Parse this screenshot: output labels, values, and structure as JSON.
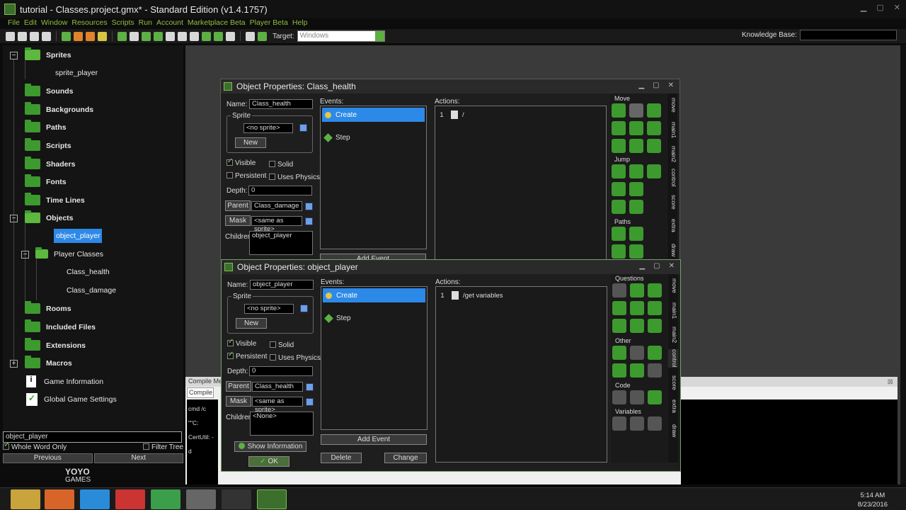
{
  "window": {
    "title": "tutorial - Classes.project.gmx* - Standard Edition (v1.4.1757)"
  },
  "menu": [
    "File",
    "Edit",
    "Window",
    "Resources",
    "Scripts",
    "Run",
    "Account",
    "Marketplace Beta",
    "Player Beta",
    "Help"
  ],
  "toolbar": {
    "target_label": "Target:",
    "target_value": "Windows",
    "knowledge_base_label": "Knowledge Base:"
  },
  "tree": {
    "sprites": "Sprites",
    "sprite_player": "sprite_player",
    "sounds": "Sounds",
    "backgrounds": "Backgrounds",
    "paths": "Paths",
    "scripts": "Scripts",
    "shaders": "Shaders",
    "fonts": "Fonts",
    "time_lines": "Time Lines",
    "objects": "Objects",
    "object_player": "object_player",
    "player_classes": "Player Classes",
    "class_health": "Class_health",
    "class_damage": "Class_damage",
    "rooms": "Rooms",
    "included_files": "Included Files",
    "extensions": "Extensions",
    "macros": "Macros",
    "game_information": "Game Information",
    "global_game_settings": "Global Game Settings"
  },
  "search": {
    "value": "object_player",
    "whole_word": "Whole Word Only",
    "filter_tree": "Filter Tree",
    "previous": "Previous",
    "next": "Next"
  },
  "logo": {
    "line1": "YOYO",
    "line2": "GAMES"
  },
  "compile": {
    "header": "Compile Me",
    "tab": "Compile",
    "line1": "cmd /c \"\"C:",
    "line2": "CertUtil: -d"
  },
  "dialog1": {
    "title": "Object Properties: Class_health",
    "name_label": "Name:",
    "name_value": "Class_health",
    "sprite_group": "Sprite",
    "sprite_value": "<no sprite>",
    "new_label": "New",
    "visible": "Visible",
    "solid": "Solid",
    "persistent": "Persistent",
    "uses_physics": "Uses Physics",
    "depth_label": "Depth:",
    "depth_value": "0",
    "parent_label": "Parent",
    "parent_value": "Class_damage",
    "mask_label": "Mask",
    "mask_value": "<same as sprite>",
    "children_label": "Children:",
    "children_value": "object_player",
    "events_label": "Events:",
    "events": [
      "Create",
      "Step"
    ],
    "add_event": "Add Event",
    "actions_label": "Actions:",
    "actions": [
      {
        "n": "1",
        "text": "/"
      }
    ],
    "lib_sections": [
      "Move",
      "Jump",
      "Paths"
    ],
    "tabs": [
      "move",
      "main1",
      "main2",
      "control",
      "score",
      "extra",
      "draw"
    ]
  },
  "dialog2": {
    "title": "Object Properties: object_player",
    "name_label": "Name:",
    "name_value": "object_player",
    "sprite_group": "Sprite",
    "sprite_value": "<no sprite>",
    "new_label": "New",
    "visible": "Visible",
    "solid": "Solid",
    "persistent": "Persistent",
    "uses_physics": "Uses Physics",
    "depth_label": "Depth:",
    "depth_value": "0",
    "parent_label": "Parent",
    "parent_value": "Class_health",
    "mask_label": "Mask",
    "mask_value": "<same as sprite>",
    "children_label": "Children:",
    "children_value": "<None>",
    "show_info": "Show Information",
    "ok": "OK",
    "events_label": "Events:",
    "events": [
      "Create",
      "Step"
    ],
    "add_event": "Add Event",
    "delete": "Delete",
    "change": "Change",
    "actions_label": "Actions:",
    "actions": [
      {
        "n": "1",
        "text": "/get variables"
      }
    ],
    "lib_sections": [
      "Questions",
      "Other",
      "Code",
      "Variables"
    ],
    "tabs": [
      "move",
      "main1",
      "main2",
      "control",
      "score",
      "extra",
      "draw"
    ]
  },
  "tray": {
    "time": "5:14 AM",
    "date": "8/23/2016"
  }
}
